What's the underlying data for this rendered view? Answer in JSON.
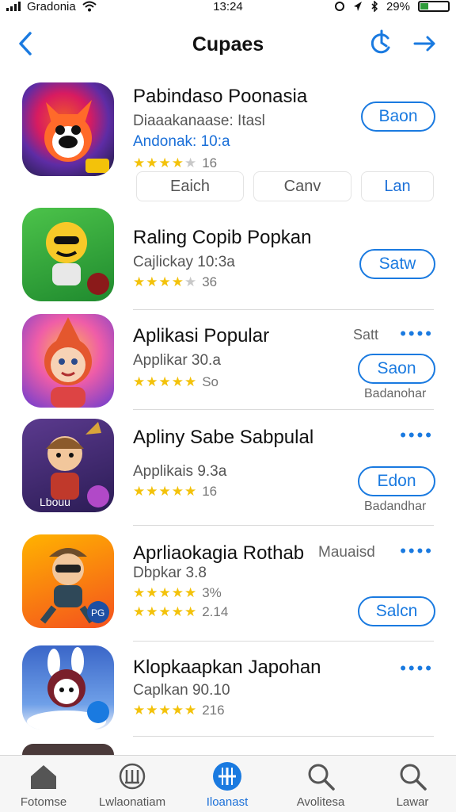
{
  "status": {
    "carrier": "Gradonia",
    "time": "13:24",
    "battery": "29%",
    "battery_level": 0.29
  },
  "nav": {
    "title": "Cupaes"
  },
  "apps": [
    {
      "name": "Pabindaso Poonasia",
      "subtitle": "Diaaakanaase: Itasl",
      "detail": "Andonak: 10:a",
      "rating": 4.5,
      "rating_count": "16",
      "button": "Baon",
      "tabs": [
        "Eaich",
        "Canv",
        "Lan"
      ]
    },
    {
      "name": "Raling Copib Popkan",
      "subtitle": "Cajlickay 10:3a",
      "rating": 4.5,
      "rating_count": "36",
      "button": "Satw"
    },
    {
      "name": "Aplikasi Popular",
      "subtitle": "Applikar 30.a",
      "rating": 5,
      "rating_count": "So",
      "side_label": "Satt",
      "button": "Saon",
      "footer": "Badanohar"
    },
    {
      "name": "Apliny Sabe Sabpulal",
      "subtitle": "Applikais 9.3a",
      "rating": 5,
      "rating_count": "16",
      "button": "Edon",
      "footer": "Badandhar",
      "icon_label": "Lbouu"
    },
    {
      "name": "Aprliaokagia Rothab",
      "side_label": "Mauaisd",
      "subtitle": "Dbpkar 3.8",
      "rating": 5,
      "rating_count": "3%",
      "rating2_count": "2.14",
      "button": "Salcn",
      "icon_label": "PG"
    },
    {
      "name": "Klopkaapkan Japohan",
      "subtitle": "Caplkan 90.10",
      "rating": 5,
      "rating_count": "216"
    }
  ],
  "tabbar": [
    {
      "label": "Fotomse",
      "icon": "home-icon"
    },
    {
      "label": "Lwlaonatiam",
      "icon": "library-icon"
    },
    {
      "label": "Iloanast",
      "icon": "add-icon"
    },
    {
      "label": "Avolitesa",
      "icon": "search-icon"
    },
    {
      "label": "Lawar",
      "icon": "search-icon"
    }
  ],
  "colors": {
    "accent": "#1a7ae0",
    "star": "#f3c20a",
    "tab_active": "#1a6fd8"
  }
}
